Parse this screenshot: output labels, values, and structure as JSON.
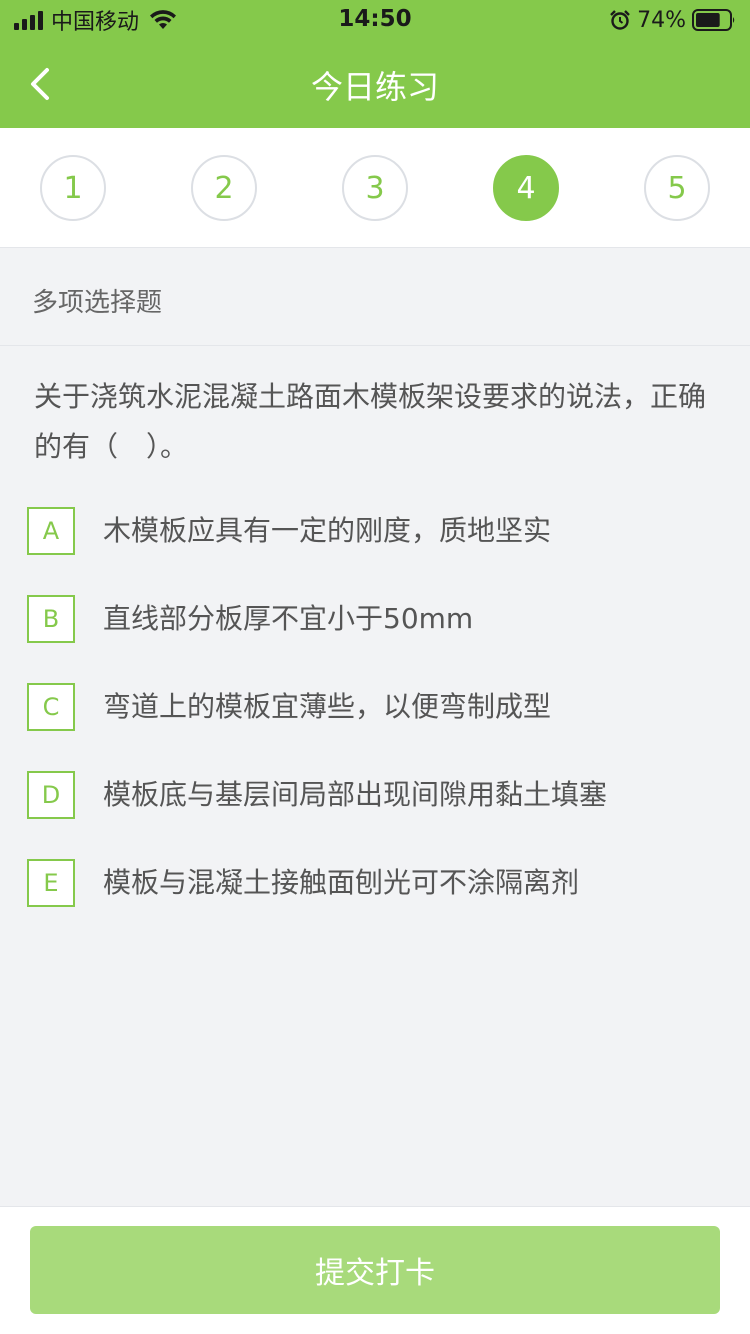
{
  "status_bar": {
    "carrier": "中国移动",
    "time": "14:50",
    "battery_percent": "74%",
    "battery_level": 0.74
  },
  "nav": {
    "title": "今日练习",
    "back_icon": "chevron-left-icon"
  },
  "steps": [
    {
      "label": "1",
      "active": false
    },
    {
      "label": "2",
      "active": false
    },
    {
      "label": "3",
      "active": false
    },
    {
      "label": "4",
      "active": true
    },
    {
      "label": "5",
      "active": false
    }
  ],
  "question": {
    "type": "多项选择题",
    "text": "关于浇筑水泥混凝土路面木模板架设要求的说法，正确的有（　）。",
    "options": [
      {
        "key": "A",
        "text": "木模板应具有一定的刚度，质地坚实"
      },
      {
        "key": "B",
        "text": "直线部分板厚不宜小于50mm"
      },
      {
        "key": "C",
        "text": "弯道上的模板宜薄些，以便弯制成型"
      },
      {
        "key": "D",
        "text": "模板底与基层间局部出现间隙用黏土填塞"
      },
      {
        "key": "E",
        "text": "模板与混凝土接触面刨光可不涂隔离剂"
      }
    ]
  },
  "footer": {
    "submit_label": "提交打卡"
  },
  "colors": {
    "accent": "#85c94b",
    "submit_disabled": "#a8da7b",
    "background": "#f2f3f5"
  }
}
